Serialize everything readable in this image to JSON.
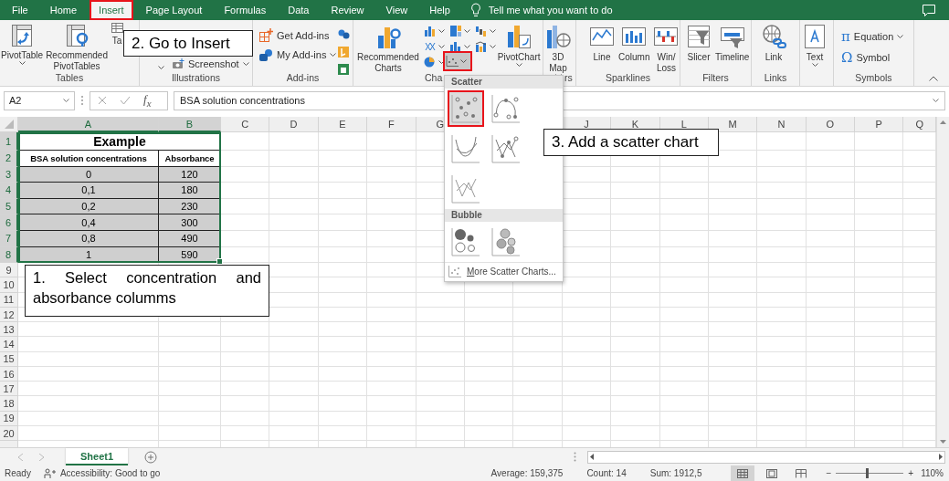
{
  "ribbon_tabs": [
    {
      "label": "File",
      "selected": false,
      "highlighted": false
    },
    {
      "label": "Home",
      "selected": false,
      "highlighted": false
    },
    {
      "label": "Insert",
      "selected": true,
      "highlighted": true
    },
    {
      "label": "Page Layout",
      "selected": false,
      "highlighted": false
    },
    {
      "label": "Formulas",
      "selected": false,
      "highlighted": false
    },
    {
      "label": "Data",
      "selected": false,
      "highlighted": false
    },
    {
      "label": "Review",
      "selected": false,
      "highlighted": false
    },
    {
      "label": "View",
      "selected": false,
      "highlighted": false
    },
    {
      "label": "Help",
      "selected": false,
      "highlighted": false
    }
  ],
  "tell_me": "Tell me what you want to do",
  "ribbon_groups": [
    {
      "label": "Tables",
      "buttons": [
        {
          "label": "PivotTable",
          "kind": "large",
          "dropdown": true
        },
        {
          "label": "Recommended PivotTables",
          "kind": "large",
          "dropdown": false
        },
        {
          "label": "Ta",
          "kind": "large",
          "dropdown": false
        }
      ]
    },
    {
      "label": "Illustrations",
      "buttons": [
        {
          "kind": "caret"
        },
        {
          "label": "Screenshot",
          "kind": "small",
          "dropdown": true
        }
      ]
    },
    {
      "label": "Add-ins",
      "buttons": [
        {
          "label": "Get Add-ins",
          "kind": "small",
          "dropdown": false
        },
        {
          "label": "My Add-ins",
          "kind": "small",
          "dropdown": true
        },
        {
          "kind": "icon"
        },
        {
          "kind": "icon"
        },
        {
          "kind": "icon"
        }
      ]
    },
    {
      "label": "Cha",
      "buttons": [
        {
          "label": "Recommended Charts",
          "kind": "large",
          "dropdown": false
        },
        {
          "label": "PivotChart",
          "kind": "large",
          "dropdown": true
        }
      ],
      "chart_types": [
        {
          "pressed": false,
          "highlighted": false
        },
        {
          "pressed": false,
          "highlighted": false
        },
        {
          "pressed": false,
          "highlighted": false
        },
        {
          "pressed": false,
          "highlighted": false
        },
        {
          "pressed": false,
          "highlighted": false
        },
        {
          "pressed": false,
          "highlighted": false
        },
        {
          "pressed": false,
          "highlighted": false
        },
        {
          "pressed": true,
          "highlighted": true
        }
      ]
    },
    {
      "label": "rs",
      "buttons": [
        {
          "label": "3D Map",
          "kind": "large",
          "dropdown": true
        }
      ]
    },
    {
      "label": "Sparklines",
      "buttons": [
        {
          "label": "Line",
          "kind": "large",
          "dropdown": false
        },
        {
          "label": "Column",
          "kind": "large",
          "dropdown": false
        },
        {
          "label": "Win/Loss",
          "kind": "large",
          "dropdown": false
        }
      ]
    },
    {
      "label": "Filters",
      "buttons": [
        {
          "label": "Slicer",
          "kind": "large",
          "dropdown": false
        },
        {
          "label": "Timeline",
          "kind": "large",
          "dropdown": false
        }
      ]
    },
    {
      "label": "Links",
      "buttons": [
        {
          "label": "Link",
          "kind": "large",
          "dropdown": false
        }
      ]
    },
    {
      "buttons": [
        {
          "label": "Text",
          "kind": "large",
          "dropdown": true
        }
      ]
    },
    {
      "label": "Symbols",
      "buttons": [
        {
          "label": "Equation",
          "glyph": "π",
          "kind": "small",
          "dropdown": true
        },
        {
          "label": "Symbol",
          "glyph": "Ω",
          "kind": "small",
          "dropdown": false
        }
      ]
    }
  ],
  "formula_bar": {
    "name_box": "A2",
    "function_label": "f$_{x}$",
    "value": "BSA solution concentrations"
  },
  "sheet": {
    "columns": [
      {
        "label": "A",
        "selected": true
      },
      {
        "label": "B",
        "selected": true
      },
      {
        "label": "C",
        "selected": false
      },
      {
        "label": "D",
        "selected": false
      },
      {
        "label": "E",
        "selected": false
      },
      {
        "label": "F",
        "selected": false
      },
      {
        "label": "G",
        "selected": false
      },
      {
        "label": "J",
        "selected": false
      },
      {
        "label": "K",
        "selected": false
      },
      {
        "label": "L",
        "selected": false
      },
      {
        "label": "M",
        "selected": false
      },
      {
        "label": "N",
        "selected": false
      },
      {
        "label": "O",
        "selected": false
      },
      {
        "label": "P",
        "selected": false
      },
      {
        "label": "Q",
        "selected": false
      }
    ],
    "rows": [
      {
        "number": "1",
        "selected": true,
        "cells": [
          {
            "text": "Example",
            "kind": "title",
            "shaded": false
          }
        ]
      },
      {
        "number": "2",
        "selected": true,
        "cells": [
          {
            "text": "BSA solution concentrations",
            "kind": "header",
            "shaded": false
          },
          {
            "text": "Absorbance",
            "kind": "header",
            "shaded": false
          }
        ]
      },
      {
        "number": "3",
        "selected": true,
        "cells": [
          {
            "text": "0",
            "kind": "value",
            "shaded": true
          },
          {
            "text": "120",
            "kind": "value",
            "shaded": true
          }
        ]
      },
      {
        "number": "4",
        "selected": true,
        "cells": [
          {
            "text": "0,1",
            "kind": "value",
            "shaded": true
          },
          {
            "text": "180",
            "kind": "value",
            "shaded": true
          }
        ]
      },
      {
        "number": "5",
        "selected": true,
        "cells": [
          {
            "text": "0,2",
            "kind": "value",
            "shaded": true
          },
          {
            "text": "230",
            "kind": "value",
            "shaded": true
          }
        ]
      },
      {
        "number": "6",
        "selected": true,
        "cells": [
          {
            "text": "0,4",
            "kind": "value",
            "shaded": true
          },
          {
            "text": "300",
            "kind": "value",
            "shaded": true
          }
        ]
      },
      {
        "number": "7",
        "selected": true,
        "cells": [
          {
            "text": "0,8",
            "kind": "value",
            "shaded": true
          },
          {
            "text": "490",
            "kind": "value",
            "shaded": true
          }
        ]
      },
      {
        "number": "8",
        "selected": true,
        "cells": [
          {
            "text": "1",
            "kind": "value",
            "shaded": true
          },
          {
            "text": "590",
            "kind": "value",
            "shaded": true
          }
        ]
      },
      {
        "number": "9",
        "selected": false
      },
      {
        "number": "10",
        "selected": false
      },
      {
        "number": "11",
        "selected": false
      },
      {
        "number": "12",
        "selected": false
      },
      {
        "number": "13",
        "selected": false
      },
      {
        "number": "14",
        "selected": false
      },
      {
        "number": "15",
        "selected": false
      },
      {
        "number": "16",
        "selected": false
      },
      {
        "number": "17",
        "selected": false
      },
      {
        "number": "18",
        "selected": false
      },
      {
        "number": "19",
        "selected": false
      },
      {
        "number": "20",
        "selected": false
      }
    ]
  },
  "sheet_tabs": [
    {
      "label": "Sheet1",
      "selected": true
    }
  ],
  "status_bar": {
    "mode": "Ready",
    "accessibility": "Accessibility: Good to go",
    "stats": [
      "Average: 159,375",
      "Count: 14",
      "Sum: 1912,5"
    ],
    "views": [
      {
        "selected": true
      },
      {
        "selected": false
      },
      {
        "selected": false
      }
    ],
    "zoom": {
      "out": "−",
      "in": "+",
      "level": 0.45,
      "reading": "110%"
    }
  },
  "chart_menu": {
    "sections": [
      {
        "title": "Scatter",
        "items": [
          {
            "highlighted": true
          },
          {
            "highlighted": false
          },
          {
            "highlighted": false
          },
          {
            "highlighted": false
          },
          {
            "highlighted": false
          }
        ]
      },
      {
        "title": "Bubble",
        "items": [
          {
            "highlighted": false
          },
          {
            "highlighted": false
          }
        ]
      }
    ],
    "footer": "More Scatter Charts..."
  },
  "callouts": [
    {
      "text": "2. Go to Insert"
    },
    {
      "text": "3. Add a scatter chart"
    },
    {
      "text": "1. Select concentration and absorbance columms"
    }
  ]
}
